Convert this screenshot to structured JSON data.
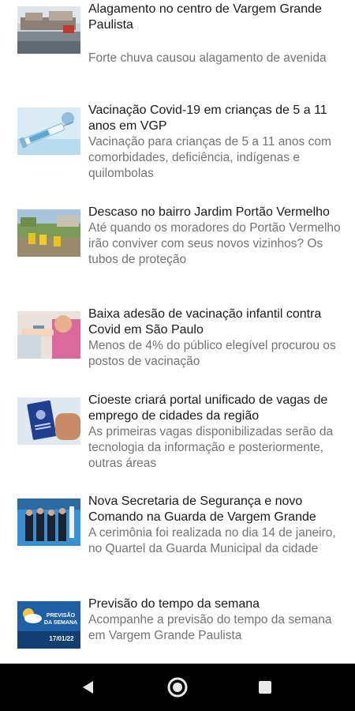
{
  "articles": [
    {
      "title": "Alagamento no centro de Vargem Grande Paulista",
      "description": "Forte chuva causou alagamento de avenida",
      "thumbnail_icon": "flooded-street-photo"
    },
    {
      "title": "Vacinação Covid-19 em crianças de 5 a 11 anos em VGP",
      "description": "Vacinação para crianças de 5 a 11 anos com comorbidades, deficiência, indígenas e quilombolas",
      "thumbnail_icon": "vaccine-syringe-photo"
    },
    {
      "title": "Descaso no bairro Jardim Portão Vermelho",
      "description": "Até quando os moradores do Portão Vermelho irão conviver com seus novos vizinhos? Os tubos de proteção",
      "thumbnail_icon": "yellow-pipes-photo"
    },
    {
      "title": "Baixa adesão de vacinação infantil contra Covid em São Paulo",
      "description": "Menos de 4% do público elegível procurou os postos de vacinação",
      "thumbnail_icon": "child-vaccination-photo"
    },
    {
      "title": "Cioeste criará portal unificado de vagas de emprego de cidades da região",
      "description": "As primeiras vagas disponibilizadas serão da tecnologia da informação e posteriormente, outras áreas",
      "thumbnail_icon": "work-card-photo"
    },
    {
      "title": "Nova Secretaria de Segurança e novo Comando na Guarda de Vargem Grande",
      "description": "A cerimônia foi realizada no dia 14 de janeiro, no Quartel da Guarda Municipal da cidade",
      "thumbnail_icon": "guard-ceremony-photo"
    },
    {
      "title": "Previsão do tempo da semana",
      "description": "Acompanhe a previsão do tempo da semana em Vargem Grande Paulista",
      "thumbnail_icon": "weather-forecast-graphic",
      "thumbnail_text_1": "PREVISÃO",
      "thumbnail_text_2": "DA SEMANA",
      "thumbnail_date": "17/01/22"
    }
  ],
  "navigation": {
    "back": "back-icon",
    "home": "home-icon",
    "recents": "recents-icon"
  }
}
